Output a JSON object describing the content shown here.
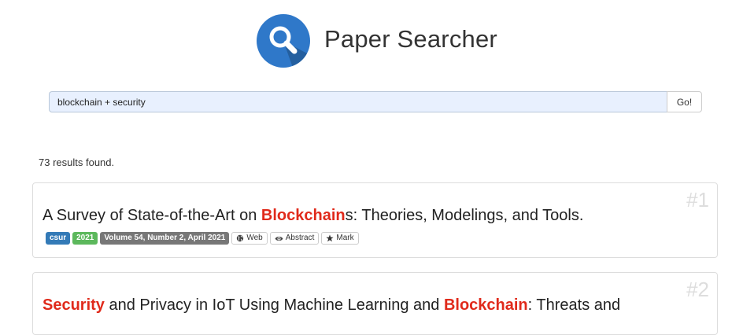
{
  "app": {
    "title": "Paper Searcher"
  },
  "search": {
    "query": "blockchain + security",
    "go_label": "Go!"
  },
  "results": {
    "count_text": "73 results found.",
    "items": [
      {
        "rank": "#1",
        "title_parts": [
          "A Survey of State-of-the-Art on ",
          "Blockchain",
          "s: Theories, Modelings, and Tools."
        ],
        "venue": "csur",
        "year": "2021",
        "volume": "Volume 54, Number 2, April 2021",
        "web_label": "Web",
        "abstract_label": "Abstract",
        "mark_label": "Mark"
      },
      {
        "rank": "#2",
        "title_parts": [
          "Security",
          " and Privacy in IoT Using Machine Learning and ",
          "Blockchain",
          ": Threats and"
        ]
      }
    ]
  },
  "colors": {
    "highlight": "#e02a1b",
    "venue_badge": "#337ab7",
    "year_badge": "#5cb85c",
    "volume_badge": "#777777",
    "logo": "#2f78c9"
  },
  "icons": {
    "logo": "magnifier-icon",
    "web": "globe-icon",
    "abstract": "eye-icon",
    "mark": "star-icon"
  }
}
